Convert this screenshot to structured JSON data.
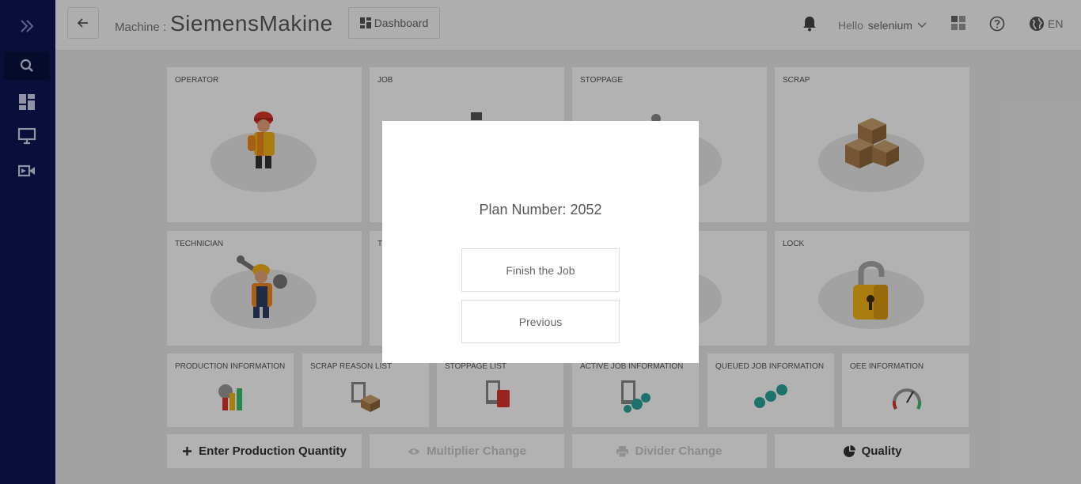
{
  "header": {
    "machine_label": "Machine :",
    "machine_name": "SiemensMakine",
    "dashboard_label": "Dashboard",
    "greeting_prefix": "Hello",
    "user_name": "selenium",
    "language": "EN"
  },
  "sidebar": {
    "items": [
      {
        "icon": "expand-icon"
      },
      {
        "icon": "search-icon"
      },
      {
        "icon": "dashboard-icon"
      },
      {
        "icon": "monitor-icon"
      },
      {
        "icon": "video-icon"
      }
    ]
  },
  "cards": {
    "operator": "OPERATOR",
    "job": "JOB",
    "stoppage": "STOPPAGE",
    "scrap": "SCRAP",
    "technician": "TECHNICIAN",
    "tool": "T",
    "lock": "LOCK"
  },
  "small_cards": {
    "production_information": "PRODUCTION INFORMATION",
    "scrap_reason_list": "SCRAP REASON LIST",
    "stoppage_list": "STOPPAGE LIST",
    "active_job_information": "ACTIVE JOB INFORMATION",
    "queued_job_information": "QUEUED JOB INFORMATION",
    "oee_information": "OEE INFORMATION"
  },
  "actions": {
    "enter_production_quantity": "Enter Production Quantity",
    "multiplier_change": "Multiplier Change",
    "divider_change": "Divider Change",
    "quality": "Quality"
  },
  "modal": {
    "plan_number_text": "Plan Number: 2052",
    "finish_label": "Finish the Job",
    "previous_label": "Previous"
  },
  "colors": {
    "sidebar": "#0d1553",
    "accent_orange": "#f08a1c",
    "disabled_text": "#c8c8c8"
  }
}
